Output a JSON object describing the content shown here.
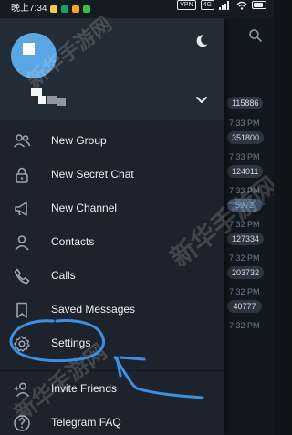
{
  "status_bar": {
    "time": "晚上7:34",
    "notification_colors": [
      "#f7c948",
      "#1aa260",
      "#f4a623",
      "#3fb950"
    ],
    "vpn_label": "VPN",
    "network_label": "4G",
    "battery_level": 0.8
  },
  "drawer": {
    "avatar_color": "#5aa5e3",
    "theme_icon": "moon-icon",
    "expand_icon": "chevron-down-icon",
    "menu": [
      {
        "label": "New Group",
        "icon": "group-icon"
      },
      {
        "label": "New Secret Chat",
        "icon": "lock-icon"
      },
      {
        "label": "New Channel",
        "icon": "megaphone-icon"
      },
      {
        "label": "Contacts",
        "icon": "contact-icon"
      },
      {
        "label": "Calls",
        "icon": "phone-icon"
      },
      {
        "label": "Saved Messages",
        "icon": "bookmark-icon"
      },
      {
        "label": "Settings",
        "icon": "gear-icon"
      },
      {
        "label": "Invite Friends",
        "icon": "add-user-icon"
      },
      {
        "label": "Telegram FAQ",
        "icon": "help-icon"
      }
    ]
  },
  "chat_list": {
    "search_icon": "search-icon",
    "rows": [
      {
        "time": "",
        "badge": "115886"
      },
      {
        "time": "7:33 PM",
        "badge": "351800"
      },
      {
        "time": "7:33 PM",
        "badge": "124011"
      },
      {
        "time": "7:33 PM",
        "badge": "5972"
      },
      {
        "time": "7:32 PM",
        "badge": "127334"
      },
      {
        "time": "7:32 PM",
        "badge": "203732"
      },
      {
        "time": "7:32 PM",
        "badge": "40777"
      },
      {
        "time": "7:32 PM",
        "badge": ""
      }
    ]
  },
  "watermark": {
    "text": "新华手游网"
  },
  "colors": {
    "accent": "#5aa5e3",
    "annotation": "#3d8fe0",
    "drawer_bg": "#1d232c"
  }
}
